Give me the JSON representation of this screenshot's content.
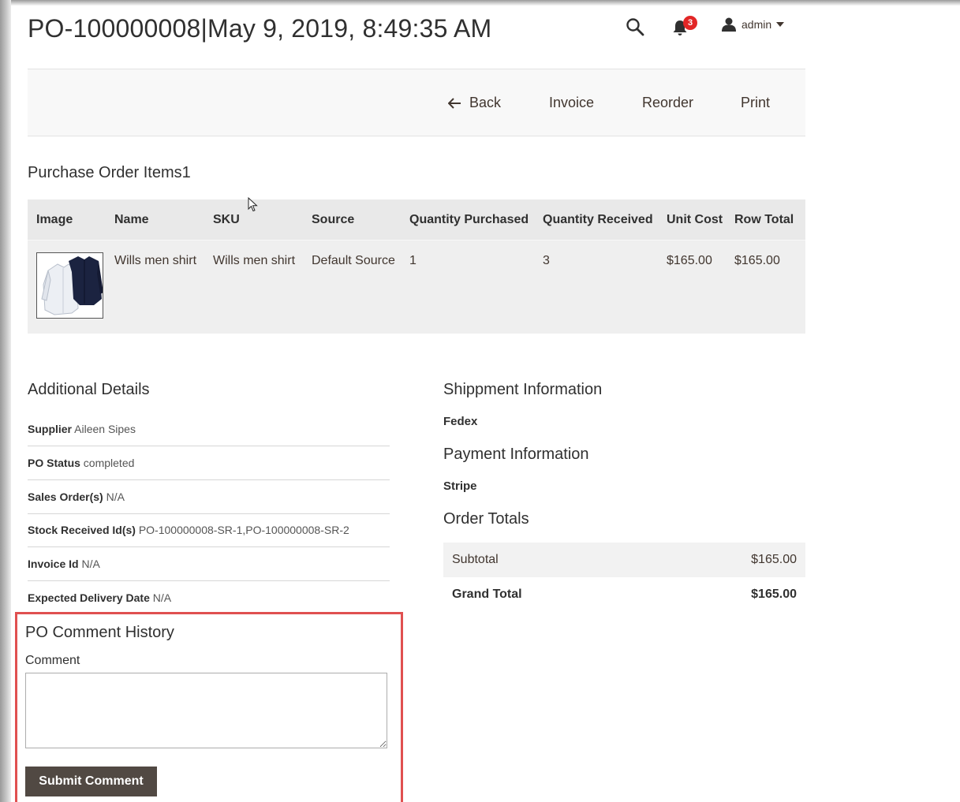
{
  "header": {
    "po_number": "PO-100000008",
    "separator": "|",
    "datetime": "May 9, 2019, 8:49:35 AM",
    "notification_count": "3",
    "user_name": "admin"
  },
  "toolbar": {
    "back_label": "Back",
    "invoice_label": "Invoice",
    "reorder_label": "Reorder",
    "print_label": "Print"
  },
  "items": {
    "title": "Purchase Order Items1",
    "columns": [
      "Image",
      "Name",
      "SKU",
      "Source",
      "Quantity Purchased",
      "Quantity Received",
      "Unit Cost",
      "Row Total"
    ],
    "rows": [
      {
        "name": "Wills men shirt",
        "sku": "Wills men shirt",
        "source": "Default Source",
        "qty_purchased": "1",
        "qty_received": "3",
        "unit_cost": "$165.00",
        "row_total": "$165.00"
      }
    ]
  },
  "additional": {
    "title": "Additional Details",
    "rows": [
      {
        "label": "Supplier",
        "value": "Aileen Sipes"
      },
      {
        "label": "PO Status",
        "value": "completed"
      },
      {
        "label": "Sales Order(s)",
        "value": "N/A"
      },
      {
        "label": "Stock Received Id(s)",
        "value": "PO-100000008-SR-1,PO-100000008-SR-2"
      },
      {
        "label": "Invoice Id",
        "value": "N/A"
      },
      {
        "label": "Expected Delivery Date",
        "value": "N/A"
      }
    ]
  },
  "shipment": {
    "title": "Shippment Information",
    "value": "Fedex"
  },
  "payment": {
    "title": "Payment Information",
    "value": "Stripe"
  },
  "totals": {
    "title": "Order Totals",
    "subtotal_label": "Subtotal",
    "subtotal_value": "$165.00",
    "grand_label": "Grand Total",
    "grand_value": "$165.00"
  },
  "comments": {
    "title": "PO Comment History",
    "field_label": "Comment",
    "textarea_value": "",
    "submit_label": "Submit Comment"
  },
  "colors": {
    "highlight_border": "#e05050",
    "button_bg": "#514943",
    "badge": "#e22626"
  }
}
